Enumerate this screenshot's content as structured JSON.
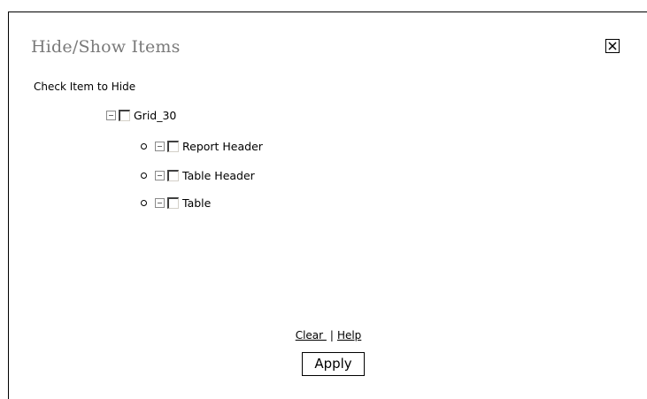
{
  "dialog": {
    "title": "Hide/Show Items",
    "close_icon": "close-x-icon"
  },
  "instruction": "Check Item to Hide",
  "tree": {
    "root": {
      "label": "Grid_30",
      "checked": false,
      "expanded": true
    },
    "children": [
      {
        "label": "Report Header",
        "checked": false,
        "expanded": true
      },
      {
        "label": "Table Header",
        "checked": false,
        "expanded": true
      },
      {
        "label": "Table",
        "checked": false,
        "expanded": true
      }
    ]
  },
  "footer": {
    "clear_label": "Clear ",
    "separator": "|",
    "help_label": "Help",
    "apply_label": "Apply"
  }
}
